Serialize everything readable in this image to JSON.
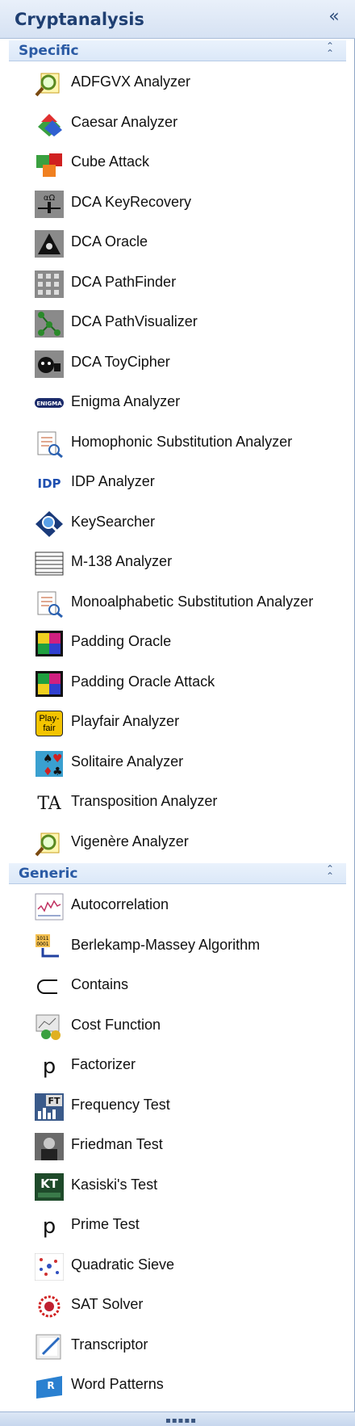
{
  "panel": {
    "title": "Cryptanalysis",
    "collapse_glyph": "«"
  },
  "sections": [
    {
      "label": "Specific",
      "items": [
        {
          "label": "ADFGVX Analyzer",
          "icon": "adfgvx-analyzer-icon"
        },
        {
          "label": "Caesar Analyzer",
          "icon": "caesar-analyzer-icon"
        },
        {
          "label": "Cube Attack",
          "icon": "cube-attack-icon"
        },
        {
          "label": "DCA KeyRecovery",
          "icon": "dca-keyrecovery-icon"
        },
        {
          "label": "DCA Oracle",
          "icon": "dca-oracle-icon"
        },
        {
          "label": "DCA PathFinder",
          "icon": "dca-pathfinder-icon"
        },
        {
          "label": "DCA PathVisualizer",
          "icon": "dca-pathvisualizer-icon"
        },
        {
          "label": "DCA ToyCipher",
          "icon": "dca-toycipher-icon"
        },
        {
          "label": "Enigma Analyzer",
          "icon": "enigma-analyzer-icon"
        },
        {
          "label": "Homophonic Substitution Analyzer",
          "icon": "homophonic-analyzer-icon"
        },
        {
          "label": "IDP Analyzer",
          "icon": "idp-analyzer-icon"
        },
        {
          "label": "KeySearcher",
          "icon": "keysearcher-icon"
        },
        {
          "label": "M-138 Analyzer",
          "icon": "m138-analyzer-icon"
        },
        {
          "label": "Monoalphabetic Substitution Analyzer",
          "icon": "monoalphabetic-analyzer-icon"
        },
        {
          "label": "Padding Oracle",
          "icon": "padding-oracle-icon"
        },
        {
          "label": "Padding Oracle Attack",
          "icon": "padding-oracle-attack-icon"
        },
        {
          "label": "Playfair Analyzer",
          "icon": "playfair-analyzer-icon"
        },
        {
          "label": "Solitaire Analyzer",
          "icon": "solitaire-analyzer-icon"
        },
        {
          "label": "Transposition Analyzer",
          "icon": "transposition-analyzer-icon"
        },
        {
          "label": "Vigenère Analyzer",
          "icon": "vigenere-analyzer-icon"
        }
      ]
    },
    {
      "label": "Generic",
      "items": [
        {
          "label": "Autocorrelation",
          "icon": "autocorrelation-icon"
        },
        {
          "label": "Berlekamp-Massey Algorithm",
          "icon": "berlekamp-massey-icon"
        },
        {
          "label": "Contains",
          "icon": "contains-icon"
        },
        {
          "label": "Cost Function",
          "icon": "cost-function-icon"
        },
        {
          "label": "Factorizer",
          "icon": "factorizer-icon"
        },
        {
          "label": "Frequency Test",
          "icon": "frequency-test-icon"
        },
        {
          "label": "Friedman Test",
          "icon": "friedman-test-icon"
        },
        {
          "label": "Kasiski's Test",
          "icon": "kasiski-test-icon"
        },
        {
          "label": "Prime Test",
          "icon": "prime-test-icon"
        },
        {
          "label": "Quadratic Sieve",
          "icon": "quadratic-sieve-icon"
        },
        {
          "label": "SAT Solver",
          "icon": "sat-solver-icon"
        },
        {
          "label": "Transcriptor",
          "icon": "transcriptor-icon"
        },
        {
          "label": "Word Patterns",
          "icon": "word-patterns-icon"
        }
      ]
    }
  ],
  "icon_text": {
    "idp": "IDP",
    "playfair": "Play-\nfair",
    "ta": "TA",
    "p": "p",
    "kt": "KT",
    "ft": "FT",
    "enigma": "ENIGMA"
  },
  "colors": {
    "title": "#1f3f72",
    "section_label": "#2a5aa4",
    "header_bg": "#dbe8f8"
  }
}
